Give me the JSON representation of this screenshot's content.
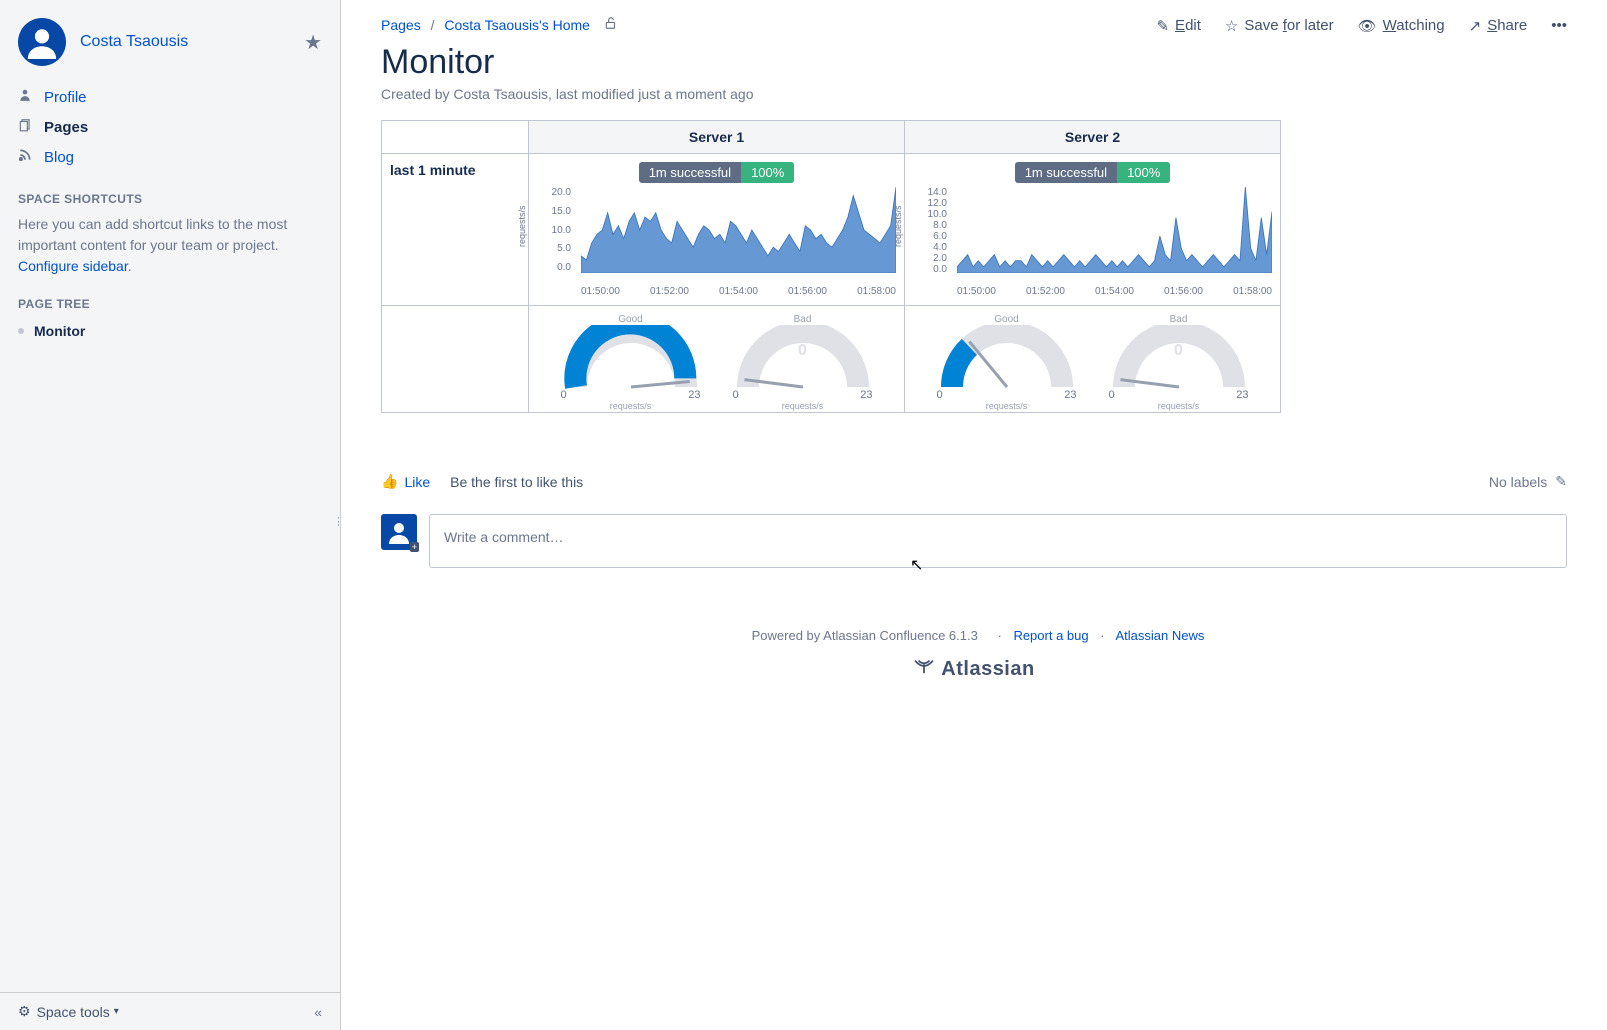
{
  "sidebar": {
    "space_name": "Costa Tsaousis",
    "nav": [
      {
        "icon": "person",
        "label": "Profile",
        "active": false
      },
      {
        "icon": "pages",
        "label": "Pages",
        "active": true
      },
      {
        "icon": "rss",
        "label": "Blog",
        "active": false
      }
    ],
    "shortcuts_heading": "SPACE SHORTCUTS",
    "shortcuts_hint_pre": "Here you can add shortcut links to the most important content for your team or project. ",
    "shortcuts_link": "Configure sidebar",
    "shortcuts_hint_post": ".",
    "tree_heading": "PAGE TREE",
    "tree": [
      {
        "label": "Monitor"
      }
    ],
    "space_tools": "Space tools"
  },
  "breadcrumb": {
    "root": "Pages",
    "sep": "/",
    "page": "Costa Tsaousis's Home"
  },
  "actions": {
    "edit": "Edit",
    "save": "Save for later",
    "watching": "Watching",
    "share": "Share"
  },
  "page": {
    "title": "Monitor",
    "meta": "Created by Costa Tsaousis, last modified just a moment ago"
  },
  "table": {
    "row_label": "last 1 minute",
    "badge_text": "1m successful",
    "badge_pct": "100%",
    "columns": [
      {
        "header": "Server 1",
        "chart": "server1",
        "gauges": {
          "good": {
            "title": "Good",
            "value": "22",
            "min": "0",
            "max": "23",
            "fill": 0.95,
            "unit": "requests/s"
          },
          "bad": {
            "title": "Bad",
            "value": "0",
            "min": "0",
            "max": "23",
            "fill": 0.02,
            "unit": "requests/s"
          }
        }
      },
      {
        "header": "Server 2",
        "chart": "server2",
        "gauges": {
          "good": {
            "title": "Good",
            "value": "6",
            "min": "0",
            "max": "23",
            "fill": 0.26,
            "unit": "requests/s"
          },
          "bad": {
            "title": "Bad",
            "value": "0",
            "min": "0",
            "max": "23",
            "fill": 0.02,
            "unit": "requests/s"
          }
        }
      }
    ]
  },
  "chart_data": [
    {
      "id": "server1",
      "type": "area",
      "xlabel": "",
      "ylabel": "requests/s",
      "ylim": [
        0,
        20
      ],
      "yticks": [
        0,
        5,
        10,
        15,
        20
      ],
      "xticks": [
        "01:50:00",
        "01:52:00",
        "01:54:00",
        "01:56:00",
        "01:58:00"
      ],
      "values": [
        4,
        3,
        7,
        9,
        10,
        14,
        9,
        11,
        8,
        12,
        14,
        10,
        13,
        12,
        14,
        10,
        8,
        7,
        12,
        10,
        8,
        6,
        9,
        11,
        10,
        8,
        9,
        7,
        12,
        11,
        9,
        7,
        10,
        8,
        6,
        4,
        6,
        5,
        7,
        9,
        7,
        5,
        11,
        10,
        8,
        9,
        7,
        6,
        8,
        10,
        13,
        18,
        14,
        10,
        9,
        8,
        7,
        9,
        11,
        20
      ]
    },
    {
      "id": "server2",
      "type": "area",
      "xlabel": "",
      "ylabel": "requests/s",
      "ylim": [
        0,
        14
      ],
      "yticks": [
        0,
        2,
        4,
        6,
        8,
        10,
        12,
        14
      ],
      "xticks": [
        "01:50:00",
        "01:52:00",
        "01:54:00",
        "01:56:00",
        "01:58:00"
      ],
      "values": [
        1,
        2,
        3,
        1,
        2,
        1,
        2,
        3,
        1,
        2,
        1,
        2,
        2,
        1,
        3,
        2,
        1,
        2,
        1,
        2,
        3,
        2,
        1,
        2,
        1,
        2,
        3,
        2,
        1,
        2,
        1,
        2,
        1,
        2,
        3,
        2,
        1,
        2,
        6,
        3,
        2,
        9,
        4,
        2,
        3,
        2,
        1,
        2,
        3,
        2,
        1,
        2,
        3,
        2,
        14,
        4,
        2,
        9,
        3,
        10
      ]
    }
  ],
  "likes": {
    "like": "Like",
    "prompt": "Be the first to like this",
    "labels": "No labels"
  },
  "comment": {
    "placeholder": "Write a comment…"
  },
  "footer": {
    "powered": "Powered by Atlassian Confluence 6.1.3",
    "bug": "Report a bug",
    "news": "Atlassian News",
    "brand": "Atlassian"
  }
}
